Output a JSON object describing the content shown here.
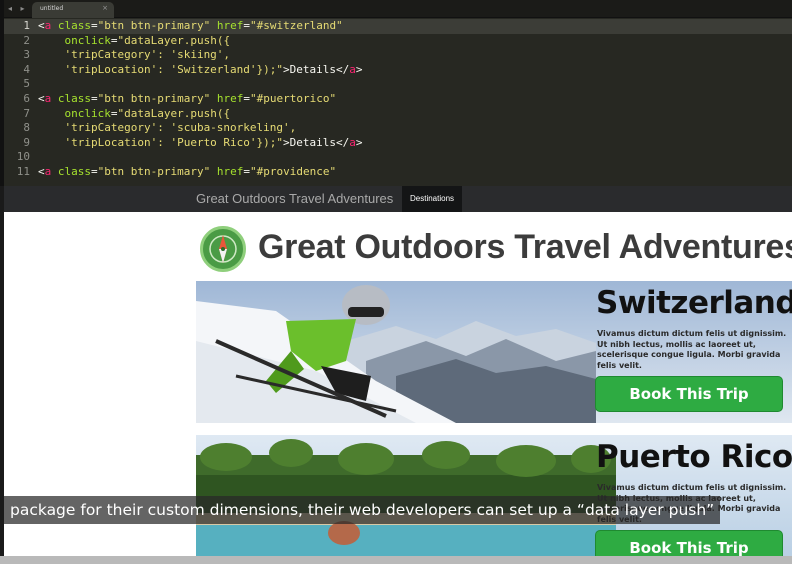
{
  "editor": {
    "tab_label": "untitled",
    "tab_close": "×",
    "nav_arrows": "◂ ▸",
    "lines": [
      {
        "n": "1",
        "parts": [
          [
            "t-pun",
            "<"
          ],
          [
            "t-tag",
            "a"
          ],
          [
            "t-pun",
            " "
          ],
          [
            "t-attr",
            "class"
          ],
          [
            "t-pun",
            "="
          ],
          [
            "t-str",
            "\"btn btn-primary\""
          ],
          [
            "t-pun",
            " "
          ],
          [
            "t-attr",
            "href"
          ],
          [
            "t-pun",
            "="
          ],
          [
            "t-str",
            "\"#switzerland\""
          ]
        ]
      },
      {
        "n": "2",
        "parts": [
          [
            "t-pun",
            "    "
          ],
          [
            "t-attr",
            "onclick"
          ],
          [
            "t-pun",
            "="
          ],
          [
            "t-str",
            "\"dataLayer.push({"
          ]
        ]
      },
      {
        "n": "3",
        "parts": [
          [
            "t-str",
            "    'tripCategory': 'skiing',"
          ]
        ]
      },
      {
        "n": "4",
        "parts": [
          [
            "t-str",
            "    'tripLocation': 'Switzerland'});\""
          ],
          [
            "t-pun",
            ">Details</"
          ],
          [
            "t-tag",
            "a"
          ],
          [
            "t-pun",
            ">"
          ]
        ]
      },
      {
        "n": "5",
        "parts": []
      },
      {
        "n": "6",
        "parts": [
          [
            "t-pun",
            "<"
          ],
          [
            "t-tag",
            "a"
          ],
          [
            "t-pun",
            " "
          ],
          [
            "t-attr",
            "class"
          ],
          [
            "t-pun",
            "="
          ],
          [
            "t-str",
            "\"btn btn-primary\""
          ],
          [
            "t-pun",
            " "
          ],
          [
            "t-attr",
            "href"
          ],
          [
            "t-pun",
            "="
          ],
          [
            "t-str",
            "\"#puertorico\""
          ]
        ]
      },
      {
        "n": "7",
        "parts": [
          [
            "t-pun",
            "    "
          ],
          [
            "t-attr",
            "onclick"
          ],
          [
            "t-pun",
            "="
          ],
          [
            "t-str",
            "\"dataLayer.push({"
          ]
        ]
      },
      {
        "n": "8",
        "parts": [
          [
            "t-str",
            "    'tripCategory': 'scuba-snorkeling',"
          ]
        ]
      },
      {
        "n": "9",
        "parts": [
          [
            "t-str",
            "    'tripLocation': 'Puerto Rico'});\""
          ],
          [
            "t-pun",
            ">Details</"
          ],
          [
            "t-tag",
            "a"
          ],
          [
            "t-pun",
            ">"
          ]
        ]
      },
      {
        "n": "10",
        "parts": []
      },
      {
        "n": "11",
        "parts": [
          [
            "t-pun",
            "<"
          ],
          [
            "t-tag",
            "a"
          ],
          [
            "t-pun",
            " "
          ],
          [
            "t-attr",
            "class"
          ],
          [
            "t-pun",
            "="
          ],
          [
            "t-str",
            "\"btn btn-primary\""
          ],
          [
            "t-pun",
            " "
          ],
          [
            "t-attr",
            "href"
          ],
          [
            "t-pun",
            "="
          ],
          [
            "t-str",
            "\"#providence\""
          ]
        ]
      }
    ],
    "current_line": "1"
  },
  "preview": {
    "brand": "Great Outdoors Travel Adventures",
    "nav_item": "Destinations",
    "site_title": "Great Outdoors Travel Adventures",
    "logo_icon": "compass-icon",
    "cards": [
      {
        "title": "Switzerland",
        "desc": "Vivamus dictum dictum felis ut dignissim. Ut nibh lectus, mollis ac laoreet ut, scelerisque congue ligula. Morbi gravida felis velit.",
        "button": "Book This Trip",
        "photo_icon": "skier-photo"
      },
      {
        "title": "Puerto Rico",
        "desc": "Vivamus dictum dictum felis ut dignissim. Ut nibh lectus, mollis ac laoreet ut, scelerisque congue ligula. Morbi gravida felis velit.",
        "button": "Book This Trip",
        "photo_icon": "beach-photo"
      }
    ]
  },
  "caption": "package for their custom dimensions, their web developers can set up a “data layer push”",
  "colors": {
    "editor_bg": "#272822",
    "keyword": "#f92672",
    "attribute": "#a6e22e",
    "string": "#e6db74",
    "button_green": "#2eab42"
  }
}
